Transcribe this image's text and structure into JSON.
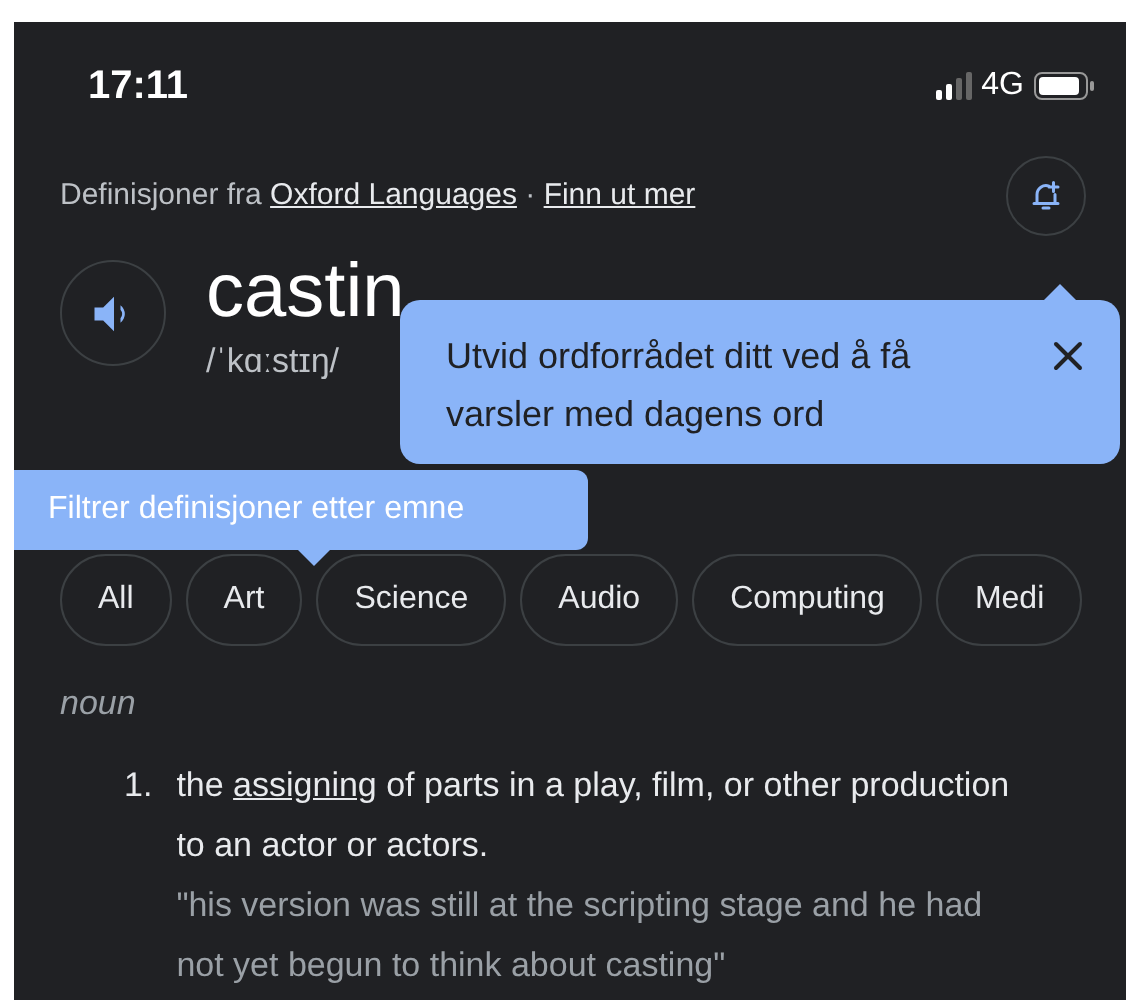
{
  "status_bar": {
    "time": "17:11",
    "network": "4G"
  },
  "source": {
    "prefix": "Definisjoner fra ",
    "link": "Oxford Languages",
    "separator": " · ",
    "more_link": "Finn ut mer"
  },
  "entry": {
    "word": "castin",
    "phonetic": "/ˈkɑːstɪŋ/"
  },
  "notification_tooltip": {
    "text": "Utvid ordforrådet ditt ved å få varsler med dagens ord"
  },
  "filter_tooltip": {
    "text": "Filtrer definisjoner etter emne"
  },
  "chips": [
    {
      "label": "All"
    },
    {
      "label": "Art"
    },
    {
      "label": "Science"
    },
    {
      "label": "Audio"
    },
    {
      "label": "Computing"
    },
    {
      "label": "Medi"
    }
  ],
  "part_of_speech": "noun",
  "definitions": [
    {
      "number": "1.",
      "text_before": "the ",
      "link": "assigning",
      "text_after": " of parts in a play, film, or other production to an actor or actors.",
      "example": "\"his version was still at the scripting stage and he had not yet begun to think about casting\""
    }
  ]
}
